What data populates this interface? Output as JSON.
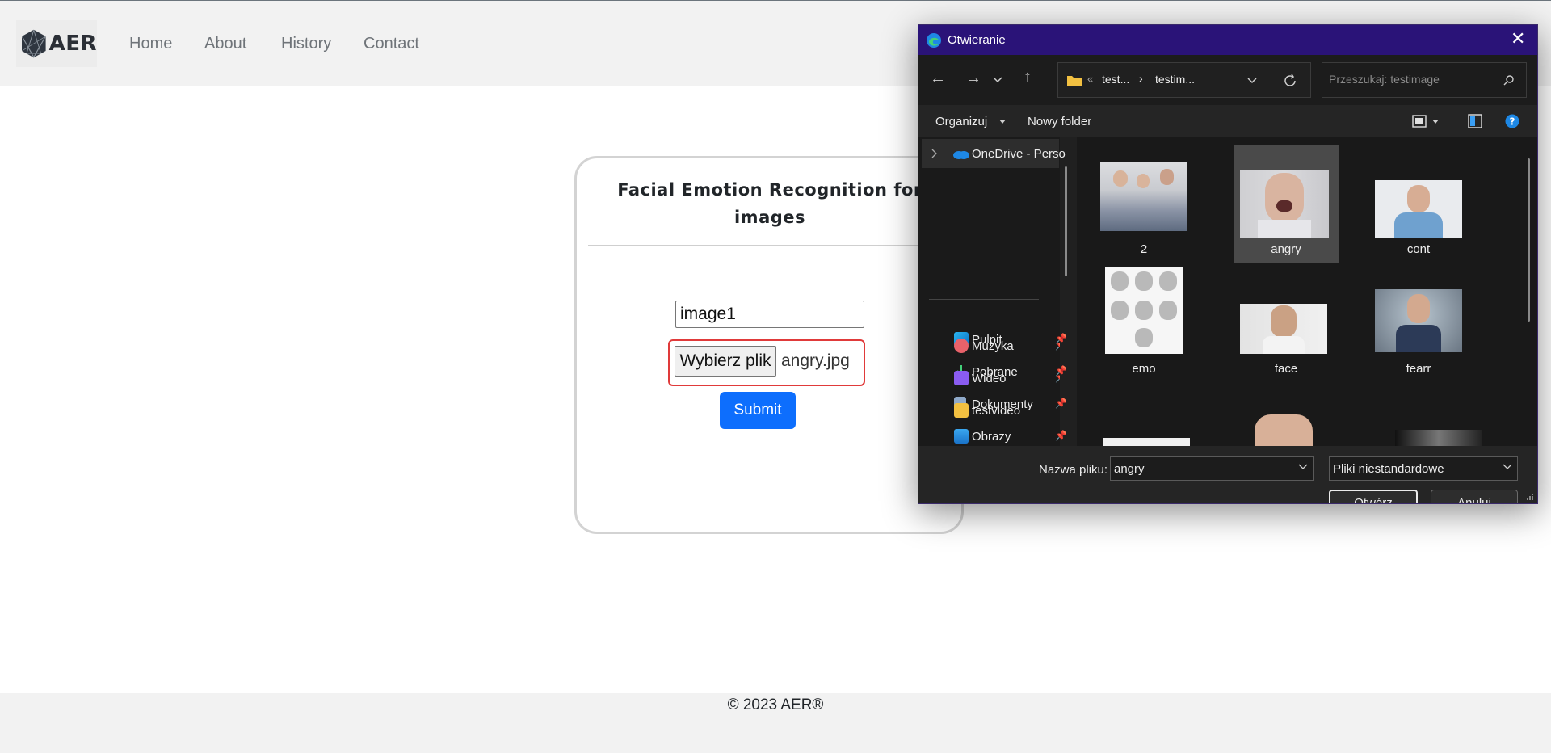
{
  "navbar": {
    "logo_text": "AER",
    "links": [
      "Home",
      "About",
      "History",
      "Contact"
    ]
  },
  "card": {
    "title_line1": "Facial Emotion Recognition for",
    "title_line2": "images",
    "name_input_value": "image1",
    "file_button_label": "Wybierz plik",
    "file_name": "angry.jpg",
    "submit_label": "Submit"
  },
  "footer": {
    "text": "© 2023 AER®"
  },
  "dialog": {
    "title": "Otwieranie",
    "path": {
      "crumb1": "test...",
      "crumb2": "testim..."
    },
    "search_placeholder": "Przeszukaj: testimage",
    "toolbar": {
      "organize": "Organizuj",
      "new_folder": "Nowy folder"
    },
    "tree": {
      "onedrive": "OneDrive - Perso",
      "items": [
        "Pulpit",
        "Pobrane",
        "Dokumenty",
        "Obrazy",
        "Muzyka",
        "Wideo",
        "testvideo"
      ]
    },
    "files": [
      "2",
      "angry",
      "cont",
      "emo",
      "face",
      "fearr"
    ],
    "filename_label": "Nazwa pliku:",
    "filename_value": "angry",
    "filetype_value": "Pliki niestandardowe",
    "open_label": "Otwórz",
    "cancel_label": "Anuluj"
  },
  "colors": {
    "primary_button": "#0d6efd",
    "highlight_border": "#e03a3a",
    "dialog_titlebar": "#2a1378"
  }
}
